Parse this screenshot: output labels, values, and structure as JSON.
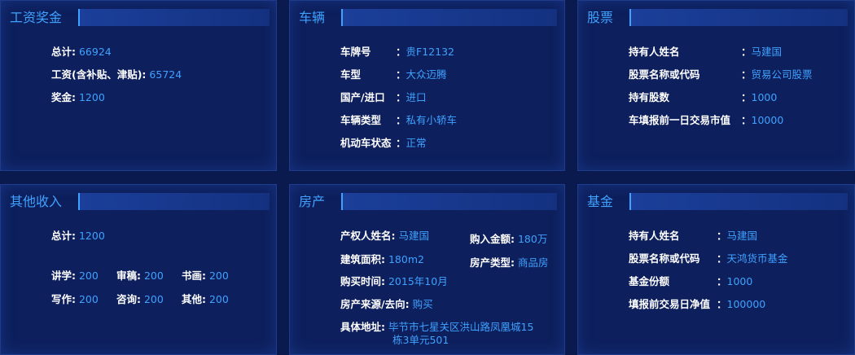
{
  "salary": {
    "title": "工资奖金",
    "rows": [
      {
        "label": "总计:",
        "value": "66924"
      },
      {
        "label": "工资(含补贴、津贴):",
        "value": "65724"
      },
      {
        "label": "奖金:",
        "value": "1200"
      }
    ]
  },
  "vehicle": {
    "title": "车辆",
    "rows": [
      {
        "label": "车牌号",
        "value": "贵F12132"
      },
      {
        "label": "车型",
        "value": "大众迈腾"
      },
      {
        "label": "国产/进口",
        "value": "进口"
      },
      {
        "label": "车辆类型",
        "value": "私有小轿车"
      },
      {
        "label": "机动车状态",
        "value": "正常"
      }
    ]
  },
  "stock": {
    "title": "股票",
    "rows": [
      {
        "label": "持有人姓名",
        "value": "马建国"
      },
      {
        "label": "股票名称或代码",
        "value": "贸易公司股票"
      },
      {
        "label": "持有股数",
        "value": "1000"
      },
      {
        "label": "车填报前一日交易市值",
        "value": "10000"
      }
    ]
  },
  "other_income": {
    "title": "其他收入",
    "total": {
      "label": "总计:",
      "value": "1200"
    },
    "items": [
      {
        "label": "讲学:",
        "value": "200"
      },
      {
        "label": "审稿:",
        "value": "200"
      },
      {
        "label": "书画:",
        "value": "200"
      },
      {
        "label": "写作:",
        "value": "200"
      },
      {
        "label": "咨询:",
        "value": "200"
      },
      {
        "label": "其他:",
        "value": "200"
      }
    ]
  },
  "property": {
    "title": "房产",
    "owner": {
      "label": "产权人姓名:",
      "value": "马建国"
    },
    "area": {
      "label": "建筑面积:",
      "value": "180m2"
    },
    "purchase_time": {
      "label": "购买时间:",
      "value": "2015年10月"
    },
    "source": {
      "label": "房产来源/去向:",
      "value": "购买"
    },
    "address": {
      "label": "具体地址:",
      "value_line1": "毕节市七星关区洪山路凤凰城15",
      "value_line2": "栋3单元501"
    },
    "amount": {
      "label": "购入金额:",
      "value": "180万"
    },
    "type": {
      "label": "房产类型:",
      "value": "商品房"
    }
  },
  "fund": {
    "title": "基金",
    "rows": [
      {
        "label": "持有人姓名",
        "value": "马建国"
      },
      {
        "label": "股票名称或代码",
        "value": "天鸿货币基金"
      },
      {
        "label": "基金份额",
        "value": "1000"
      },
      {
        "label": "填报前交易日净值",
        "value": "100000"
      }
    ]
  },
  "colon_mark": "："
}
